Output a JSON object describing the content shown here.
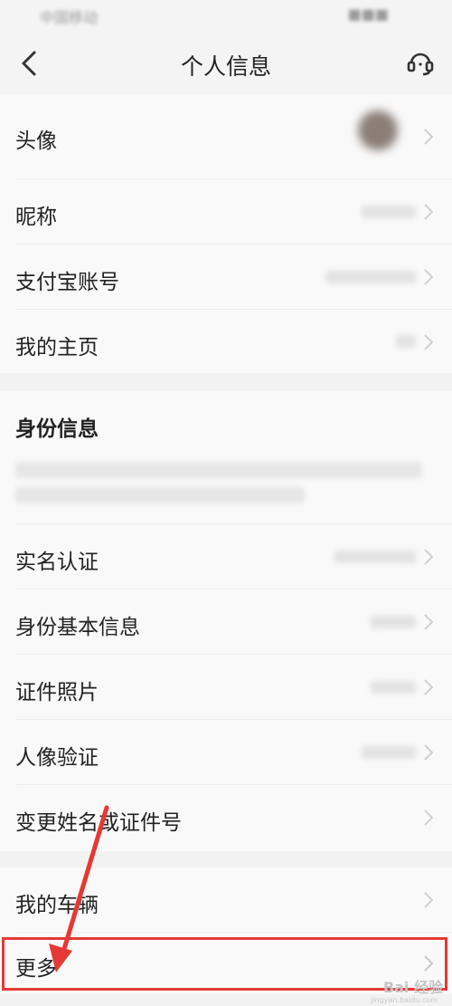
{
  "status_bar": {
    "carrier": "中国移动",
    "right": "■■■"
  },
  "nav": {
    "title": "个人信息",
    "back_icon": "chevron-left-icon",
    "support_icon": "headset-icon"
  },
  "profile_rows": [
    {
      "label": "头像"
    },
    {
      "label": "昵称"
    },
    {
      "label": "支付宝账号"
    },
    {
      "label": "我的主页"
    }
  ],
  "identity": {
    "title": "身份信息",
    "rows": [
      {
        "label": "实名认证"
      },
      {
        "label": "身份基本信息"
      },
      {
        "label": "证件照片"
      },
      {
        "label": "人像验证"
      },
      {
        "label": "变更姓名或证件号"
      }
    ]
  },
  "other_rows": [
    {
      "label": "我的车辆"
    },
    {
      "label": "更多"
    }
  ],
  "watermark": {
    "text": "Bai 经验",
    "sub": "jingyan.baidu.com"
  },
  "colors": {
    "highlight": "#e53935",
    "page_bg": "#f2f2f2",
    "row_bg": "#f9f9f9"
  }
}
